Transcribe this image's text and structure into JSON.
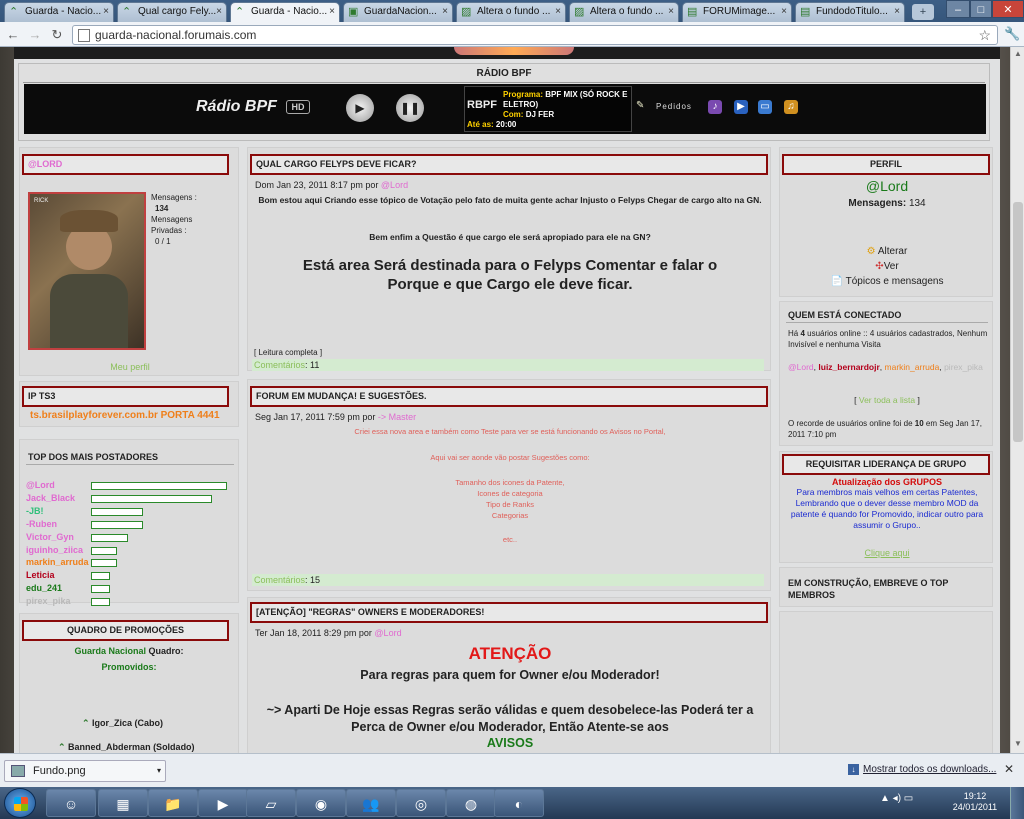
{
  "browser": {
    "tabs": [
      {
        "label": "Guarda - Nacio...",
        "icon": "chevron-rank-icon"
      },
      {
        "label": "Qual cargo Fely...",
        "icon": "chevron-rank-icon"
      },
      {
        "label": "Guarda - Nacio...",
        "icon": "chevron-rank-icon",
        "active": true
      },
      {
        "label": "GuardaNacion...",
        "icon": "chat-icon"
      },
      {
        "label": "Altera o fundo ...",
        "icon": "image-icon"
      },
      {
        "label": "Altera o fundo ...",
        "icon": "image-icon"
      },
      {
        "label": "FORUMimage...",
        "icon": "picture-icon"
      },
      {
        "label": "FundodoTitulo...",
        "icon": "picture-icon"
      }
    ],
    "url": "guarda-nacional.forumais.com"
  },
  "radio": {
    "title": "RÁDIO BPF",
    "logo": "Rádio BPF",
    "hd": "HD",
    "screen_logo": "RBPF",
    "program_label": "Programa:",
    "program": "BPF MIX (SÓ ROCK E ELETRO)",
    "com_label": "Com:",
    "host": "DJ FER",
    "until_label": "Até as:",
    "until": "20:00",
    "requests": "Pedidos"
  },
  "left": {
    "user_header": "@LORD",
    "photo_caption": "RICK",
    "stats": {
      "mensagens_label": "Mensagens :",
      "mensagens": "134",
      "privadas_label": "Mensagens Privadas :",
      "privadas": "0 / 1"
    },
    "profile_link": "Meu perfil",
    "ts3_header": "IP TS3",
    "ts3_value": "ts.brasilplayforever.com.br PORTA 4441",
    "top_header": "TOP DOS MAIS POSTADORES",
    "top_posters": [
      {
        "name": "@Lord",
        "color": "#e06ad0",
        "fill": 1.0
      },
      {
        "name": "Jack_Black",
        "color": "#e06ad0",
        "fill": 0.89
      },
      {
        "name": "-JB!",
        "color": "#2fbf7a",
        "fill": 0.38
      },
      {
        "name": "-Ruben",
        "color": "#e06ad0",
        "fill": 0.38
      },
      {
        "name": "Victor_Gyn",
        "color": "#e06ad0",
        "fill": 0.27
      },
      {
        "name": "iguinho_ziica",
        "color": "#e06ad0",
        "fill": 0.19
      },
      {
        "name": "markin_arruda",
        "color": "#ef7f1a",
        "fill": 0.19
      },
      {
        "name": "Leticia",
        "color": "#b3001b",
        "fill": 0.14
      },
      {
        "name": "edu_241",
        "color": "#1a7a1a",
        "fill": 0.14
      },
      {
        "name": "pirex_pika",
        "color": "#b9b9b9",
        "fill": 0.14
      }
    ],
    "promo_header": "QUADRO DE PROMOÇÕES",
    "promo_line1_green": "Guarda Nacional",
    "promo_line1_rest": " Quadro:",
    "promo_line2": "Promovidos:",
    "promotions": [
      "Igor_Zica (Cabo)",
      "Banned_Abderman (Soldado)"
    ]
  },
  "center": {
    "posts": [
      {
        "title": "QUAL CARGO FELYPS DEVE FICAR?",
        "date": "Dom Jan 23, 2011 8:17 pm por ",
        "author": "@Lord",
        "body1": "Bom estou aqui Criando esse tópico de Votação pelo fato de muita gente achar Injusto o Felyps Chegar de cargo alto na GN.",
        "body2": "Bem enfim a Questão é que cargo ele será apropiado para ele na GN?",
        "body3": "Está area Será destinada para o Felyps Comentar e falar o Porque e que Cargo ele deve ficar.",
        "readmore": "[ Leitura completa ]",
        "comments_label": "Comentários",
        "comments": "11"
      },
      {
        "title": "FORUM EM MUDANÇA! E SUGESTÕES.",
        "date": "Seg Jan 17, 2011 7:59 pm por ",
        "author": "-> Master",
        "lines": [
          "Criei essa nova area e também como Teste para ver se está funcionando os Avisos no Portal,",
          "Aqui vai ser aonde vão postar Sugestões como:",
          "Tamanho dos icones da Patente,",
          "Icones de categoria",
          "Tipo de Ranks",
          "Categorias",
          "etc.."
        ],
        "comments_label": "Comentários",
        "comments": "15"
      },
      {
        "title": "[ATENÇÃO] \"REGRAS\" OWNERS E MODERADORES!",
        "date": "Ter Jan 18, 2011 8:29 pm por ",
        "author": "@Lord",
        "attention": "ATENÇÃO",
        "rule1": "Para regras para quem for Owner e/ou Moderador!",
        "rule2": "~> Aparti De Hoje essas Regras serão válidas e quem desobelece-las Poderá ter a Perca de Owner e/ou Moderador, Então Atente-se aos",
        "avisos": "AVISOS"
      }
    ]
  },
  "right": {
    "perfil_header": "PERFIL",
    "perfil_name": "@Lord",
    "perfil_msgs_label": "Mensagens:",
    "perfil_msgs": "134",
    "alterar": "Alterar",
    "ver": "Ver",
    "topicos": "Tópicos e mensagens",
    "online_header": "QUEM ESTÁ CONECTADO",
    "online_text_pre": "Há ",
    "online_count": "4",
    "online_text_post": " usuários online :: 4 usuários cadastrados, Nenhum Invisível e nenhuma Visita",
    "online_users": [
      {
        "name": "@Lord",
        "color": "#e06ad0"
      },
      {
        "name": "luiz_bernardojr",
        "color": "#b3001b"
      },
      {
        "name": "markin_arruda",
        "color": "#ef7f1a"
      },
      {
        "name": "pirex_pika",
        "color": "#b9b9b9"
      }
    ],
    "see_all": "Ver toda a lista",
    "record_pre": "O recorde de usuários online foi de ",
    "record_count": "10",
    "record_post": " em Seg Jan 17, 2011 7:10 pm",
    "req_header": "REQUISITAR LIDERANÇA DE GRUPO",
    "req_title": "Atualização dos GRUPOS",
    "req_body": "Para membros mais velhos em certas Patentes, Lembrando que o dever desse membro MOD da patente é quando for Promovido, indicar outro para assumir o Grupo..",
    "req_link": "Clique aqui",
    "construction_header": "EM CONSTRUÇÃO, EMBREVE O TOP MEMBROS"
  },
  "downloads": {
    "file": "Fundo.png",
    "show_all": "Mostrar todos os downloads..."
  },
  "taskbar": {
    "time": "19:12",
    "date": "24/01/2011"
  }
}
